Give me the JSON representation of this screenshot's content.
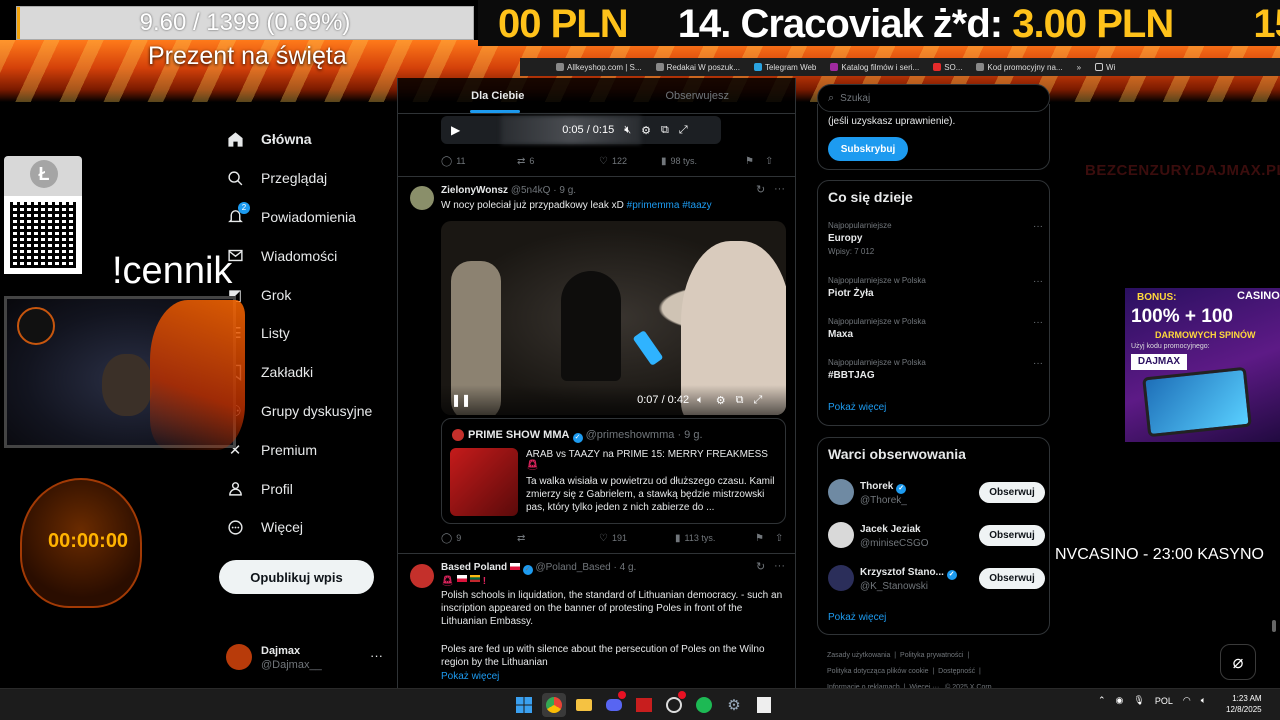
{
  "overlay": {
    "goal_text": "9.60 / 1399 (0.69%)",
    "goal_fraction": 0.0069,
    "goal_caption": "Prezent na święta",
    "ticker_parts": [
      "00 PLN",
      "14. Cracoviak ż*d: ",
      "3.00 PLN",
      "15"
    ],
    "cennik": "!cennik",
    "timer": "00:00:00",
    "watermark": "BEZCENZURY.DAJMAX.PL",
    "casino": {
      "bonus": "BONUS:",
      "brand": "CASINO",
      "headline": "100% + 100",
      "free_spins": "DARMOWYCH SPINÓW",
      "code_label": "Użyj kodu promocyjnego:",
      "code": "DAJMAX"
    },
    "nvcasino": "NVCASINO -  23:00 KASYNO"
  },
  "browser": {
    "bookmarks": [
      "Allkeyshop.com | S...",
      "Redakai W poszuk...",
      "Telegram Web",
      "Katalog filmów i seri...",
      "SO...",
      "Kod promocyjny na...",
      "Wi"
    ]
  },
  "sidebar": {
    "items": [
      {
        "label": "Główna",
        "icon": "home-icon"
      },
      {
        "label": "Przeglądaj",
        "icon": "search-icon"
      },
      {
        "label": "Powiadomienia",
        "icon": "bell-icon",
        "badge": "2"
      },
      {
        "label": "Wiadomości",
        "icon": "envelope-icon"
      },
      {
        "label": "Grok",
        "icon": "grok-icon"
      },
      {
        "label": "Listy",
        "icon": "list-icon"
      },
      {
        "label": "Zakładki",
        "icon": "bookmark-icon"
      },
      {
        "label": "Grupy dyskusyjne",
        "icon": "people-icon"
      },
      {
        "label": "Premium",
        "icon": "x-premium-icon"
      },
      {
        "label": "Profil",
        "icon": "profile-icon"
      },
      {
        "label": "Więcej",
        "icon": "more-circle-icon"
      }
    ],
    "post_button": "Opublikuj wpis",
    "account": {
      "name": "Dajmax",
      "handle": "@Dajmax__"
    }
  },
  "timeline": {
    "tabs": [
      "Dla Ciebie",
      "Obserwujesz"
    ],
    "top_player_time": "0:05 / 0:15",
    "tweet0_stats": {
      "replies": "11",
      "reposts": "6",
      "likes": "122",
      "views": "98 tys."
    },
    "tweet1": {
      "name": "ZielonyWonsz",
      "handle": "@5n4kQ",
      "time": "9 g.",
      "text": "W nocy poleciał już przypadkowy leak xD",
      "tags": "#primemma #taazy",
      "video_time": "0:07 / 0:42",
      "quote": {
        "name": "PRIME SHOW MMA",
        "handle": "@primeshowmma",
        "time": "9 g.",
        "title": "ARAB vs TAAZY na PRIME 15: MERRY FREAKMESS",
        "text": "Ta walka wisiała w powietrzu od dłuższego czasu. Kamil zmierzy się z Gabrielem, a stawką będzie mistrzowski pas, który tylko jeden z nich zabierze do ..."
      },
      "stats": {
        "replies": "9",
        "reposts": "",
        "likes": "191",
        "views": "113 tys."
      }
    },
    "tweet2": {
      "name": "Based Poland",
      "handle": "@Poland_Based",
      "time": "4 g.",
      "text1": "Polish schools in liquidation, the standard of Lithuanian democracy. - such an inscription appeared on the banner of protesting Poles in front of the Lithuanian Embassy.",
      "text2": "Poles are fed up with silence about the persecution of Poles on the Wilno region by the Lithuanian",
      "show_more": "Pokaż więcej"
    }
  },
  "right": {
    "search_placeholder": "Szukaj",
    "subscribe_text": "(jeśli uzyskasz uprawnienie).",
    "subscribe_button": "Subskrybuj",
    "trends_title": "Co się dzieje",
    "trends": [
      {
        "meta": "Najpopularniejsze",
        "name": "Europy",
        "sub": "Wpisy: 7 012"
      },
      {
        "meta": "Najpopularniejsze w Polska",
        "name": "Piotr Żyła",
        "sub": ""
      },
      {
        "meta": "Najpopularniejsze w Polska",
        "name": "Maxa",
        "sub": ""
      },
      {
        "meta": "Najpopularniejsze w Polska",
        "name": "#BBTJAG",
        "sub": ""
      }
    ],
    "trends_more": "Pokaż więcej",
    "follow_title": "Warci obserwowania",
    "follow": [
      {
        "name": "Thorek",
        "handle": "@Thorek_",
        "button": "Obserwuj"
      },
      {
        "name": "Jacek Jeziak",
        "handle": "@miniseCSGO",
        "button": "Obserwuj"
      },
      {
        "name": "Krzysztof Stano...",
        "handle": "@K_Stanowski",
        "button": "Obserwuj"
      }
    ],
    "follow_more": "Pokaż więcej",
    "footer": {
      "l1": "Zasady użytkowania",
      "l2": "Polityka prywatności",
      "l3": "Polityka dotycząca plików cookie",
      "l4": "Dostępność",
      "l5": "Informacje o reklamach",
      "l6": "Więcej ···",
      "l7": "© 2025 X Corp."
    }
  },
  "taskbar": {
    "lang": "POL",
    "time": "1:23 AM",
    "date": "12/8/2025"
  }
}
